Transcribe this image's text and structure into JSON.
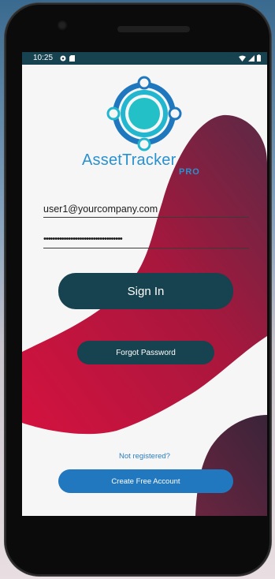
{
  "status_bar": {
    "time": "10:25",
    "left_icons": [
      "settings-icon",
      "sd-card-icon"
    ],
    "right_icons": [
      "wifi-icon",
      "signal-icon",
      "battery-icon"
    ]
  },
  "app": {
    "brand_name": "AssetTracker",
    "brand_suffix": "PRO"
  },
  "form": {
    "email_value": "user1@yourcompany.com",
    "password_mask": "•••••••••••••••••••••••••••••••••••"
  },
  "buttons": {
    "sign_in": "Sign In",
    "forgot_password": "Forgot Password",
    "create_account": "Create Free Account"
  },
  "links": {
    "not_registered": "Not registered?"
  },
  "navigation": {
    "items": [
      "back-icon",
      "home-icon",
      "recents-icon"
    ]
  },
  "colors": {
    "primary_dark": "#174250",
    "accent_blue": "#2a91cf",
    "create_button": "#2278be",
    "blob_start": "#d4123f",
    "blob_end": "#5a2a45"
  }
}
